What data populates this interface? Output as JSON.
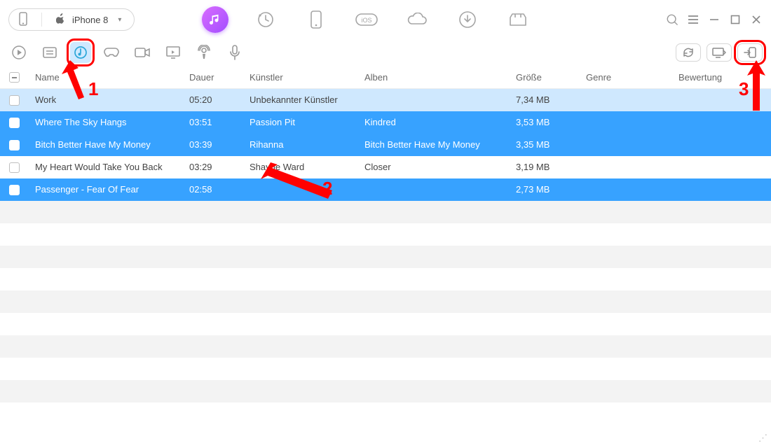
{
  "device": {
    "name": "iPhone 8"
  },
  "columns": {
    "name": "Name",
    "dauer": "Dauer",
    "kuenstler": "Künstler",
    "alben": "Alben",
    "groesse": "Größe",
    "genre": "Genre",
    "bewertung": "Bewertung"
  },
  "rows": [
    {
      "checked": false,
      "selected": false,
      "highlight": true,
      "name": "Work",
      "dauer": "05:20",
      "kuenstler": "Unbekannter Künstler",
      "alben": "",
      "groesse": "7,34 MB",
      "genre": "",
      "bewertung": ""
    },
    {
      "checked": true,
      "selected": true,
      "name": "Where The Sky Hangs",
      "dauer": "03:51",
      "kuenstler": "Passion Pit",
      "alben": "Kindred",
      "groesse": "3,53 MB",
      "genre": "",
      "bewertung": ""
    },
    {
      "checked": true,
      "selected": true,
      "name": "Bitch Better Have My Money",
      "dauer": "03:39",
      "kuenstler": "Rihanna",
      "alben": "Bitch Better Have My Money",
      "groesse": "3,35 MB",
      "genre": "",
      "bewertung": ""
    },
    {
      "checked": false,
      "selected": false,
      "name": "My Heart Would Take You Back",
      "dauer": "03:29",
      "kuenstler": "Shayne Ward",
      "alben": "Closer",
      "groesse": "3,19 MB",
      "genre": "",
      "bewertung": ""
    },
    {
      "checked": true,
      "selected": true,
      "name": "Passenger - Fear Of Fear",
      "dauer": "02:58",
      "kuenstler": "",
      "alben": "",
      "groesse": "2,73 MB",
      "genre": "",
      "bewertung": ""
    }
  ],
  "annotations": {
    "n1": "1",
    "n2": "2",
    "n3": "3"
  },
  "icons": {
    "device": "iphone",
    "apple": "apple",
    "music": "music-note",
    "backup": "clock-arrow",
    "phone": "phone-outline",
    "ios": "ios-badge",
    "icloud": "cloud",
    "download": "download-circle",
    "merge": "tshirt",
    "search": "magnifier",
    "menu": "hamburger",
    "min": "minimize",
    "max": "maximize",
    "close": "close",
    "play": "play-circle",
    "playlist": "list",
    "songs": "music-mark",
    "games": "gamepad",
    "video": "video-camera",
    "screen": "monitor",
    "podcast": "podcast",
    "voice": "microphone",
    "refresh": "refresh",
    "topc": "to-pc",
    "todevice": "to-device"
  }
}
